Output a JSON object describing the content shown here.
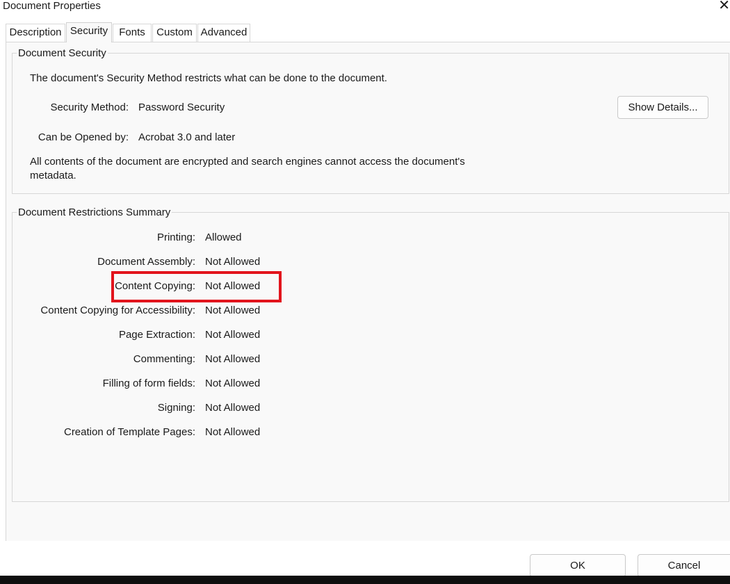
{
  "window": {
    "title": "Document Properties",
    "close_glyph": "✕"
  },
  "tabs": [
    {
      "label": "Description",
      "active": false
    },
    {
      "label": "Security",
      "active": true
    },
    {
      "label": "Fonts",
      "active": false
    },
    {
      "label": "Custom",
      "active": false
    },
    {
      "label": "Advanced",
      "active": false
    }
  ],
  "document_security": {
    "legend": "Document Security",
    "intro": "The document's Security Method restricts what can be done to the document.",
    "security_method_label": "Security Method:",
    "security_method_value": "Password Security",
    "opened_by_label": "Can be Opened by:",
    "opened_by_value": "Acrobat 3.0 and later",
    "note_line1": "All contents of the document are encrypted and search engines cannot access the document's",
    "note_line2": "metadata.",
    "show_details_label": "Show Details..."
  },
  "restrictions": {
    "legend": "Document Restrictions Summary",
    "rows": [
      {
        "label": "Printing:",
        "value": "Allowed"
      },
      {
        "label": "Document Assembly:",
        "value": "Not Allowed"
      },
      {
        "label": "Content Copying:",
        "value": "Not Allowed",
        "highlighted": true
      },
      {
        "label": "Content Copying for Accessibility:",
        "value": "Not Allowed"
      },
      {
        "label": "Page Extraction:",
        "value": "Not Allowed"
      },
      {
        "label": "Commenting:",
        "value": "Not Allowed"
      },
      {
        "label": "Filling of form fields:",
        "value": "Not Allowed"
      },
      {
        "label": "Signing:",
        "value": "Not Allowed"
      },
      {
        "label": "Creation of Template Pages:",
        "value": "Not Allowed"
      }
    ]
  },
  "footer": {
    "ok_label": "OK",
    "cancel_label": "Cancel"
  },
  "colors": {
    "highlight": "#e2141c",
    "panel_bg": "#f9f9f9",
    "border": "#d7d7d7"
  }
}
